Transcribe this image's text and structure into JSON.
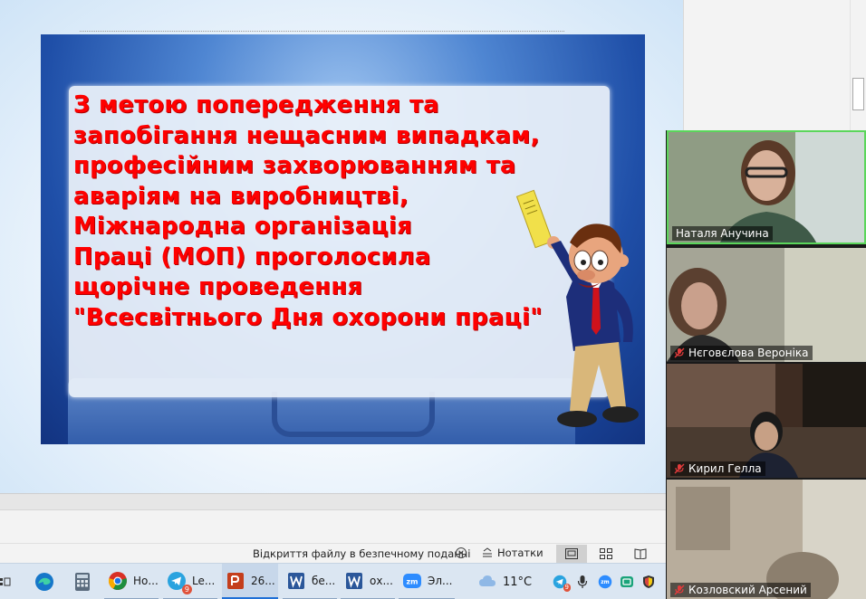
{
  "slide": {
    "lines": [
      "З метою попередження та",
      "запобігання нещасним випадкам,",
      "професійним захворюванням та",
      "аваріям на виробництві,",
      "Міжнародна організація",
      "Праці (МОП) проголосила",
      "щорічне проведення",
      "\"Всесвітнього Дня охорони праці\""
    ],
    "text_color": "#ff0000"
  },
  "participants": [
    {
      "name": "Наталя Анучина",
      "muted": false,
      "active": true
    },
    {
      "name": "Нєговєлова Вероніка",
      "muted": true,
      "active": false
    },
    {
      "name": "Кирил Гелла",
      "muted": true,
      "active": false
    },
    {
      "name": "Козловский Арсений",
      "muted": true,
      "active": false
    }
  ],
  "status_bar": {
    "message": "Відкриття файлу в безпечному поданні",
    "notes_label": "Нотатки"
  },
  "taskbar": {
    "items": [
      {
        "icon": "edge-icon",
        "label": ""
      },
      {
        "icon": "calculator-icon",
        "label": ""
      },
      {
        "icon": "chrome-icon",
        "label": "Но..."
      },
      {
        "icon": "telegram-icon",
        "label": "Le...",
        "badge": "9"
      },
      {
        "icon": "powerpoint-icon",
        "label": "26..."
      },
      {
        "icon": "word-icon",
        "label": "бе..."
      },
      {
        "icon": "word-icon",
        "label": "ох..."
      },
      {
        "icon": "zoom-icon",
        "label": "Эл..."
      }
    ],
    "weather": "11°C",
    "tray_badge": "9"
  }
}
